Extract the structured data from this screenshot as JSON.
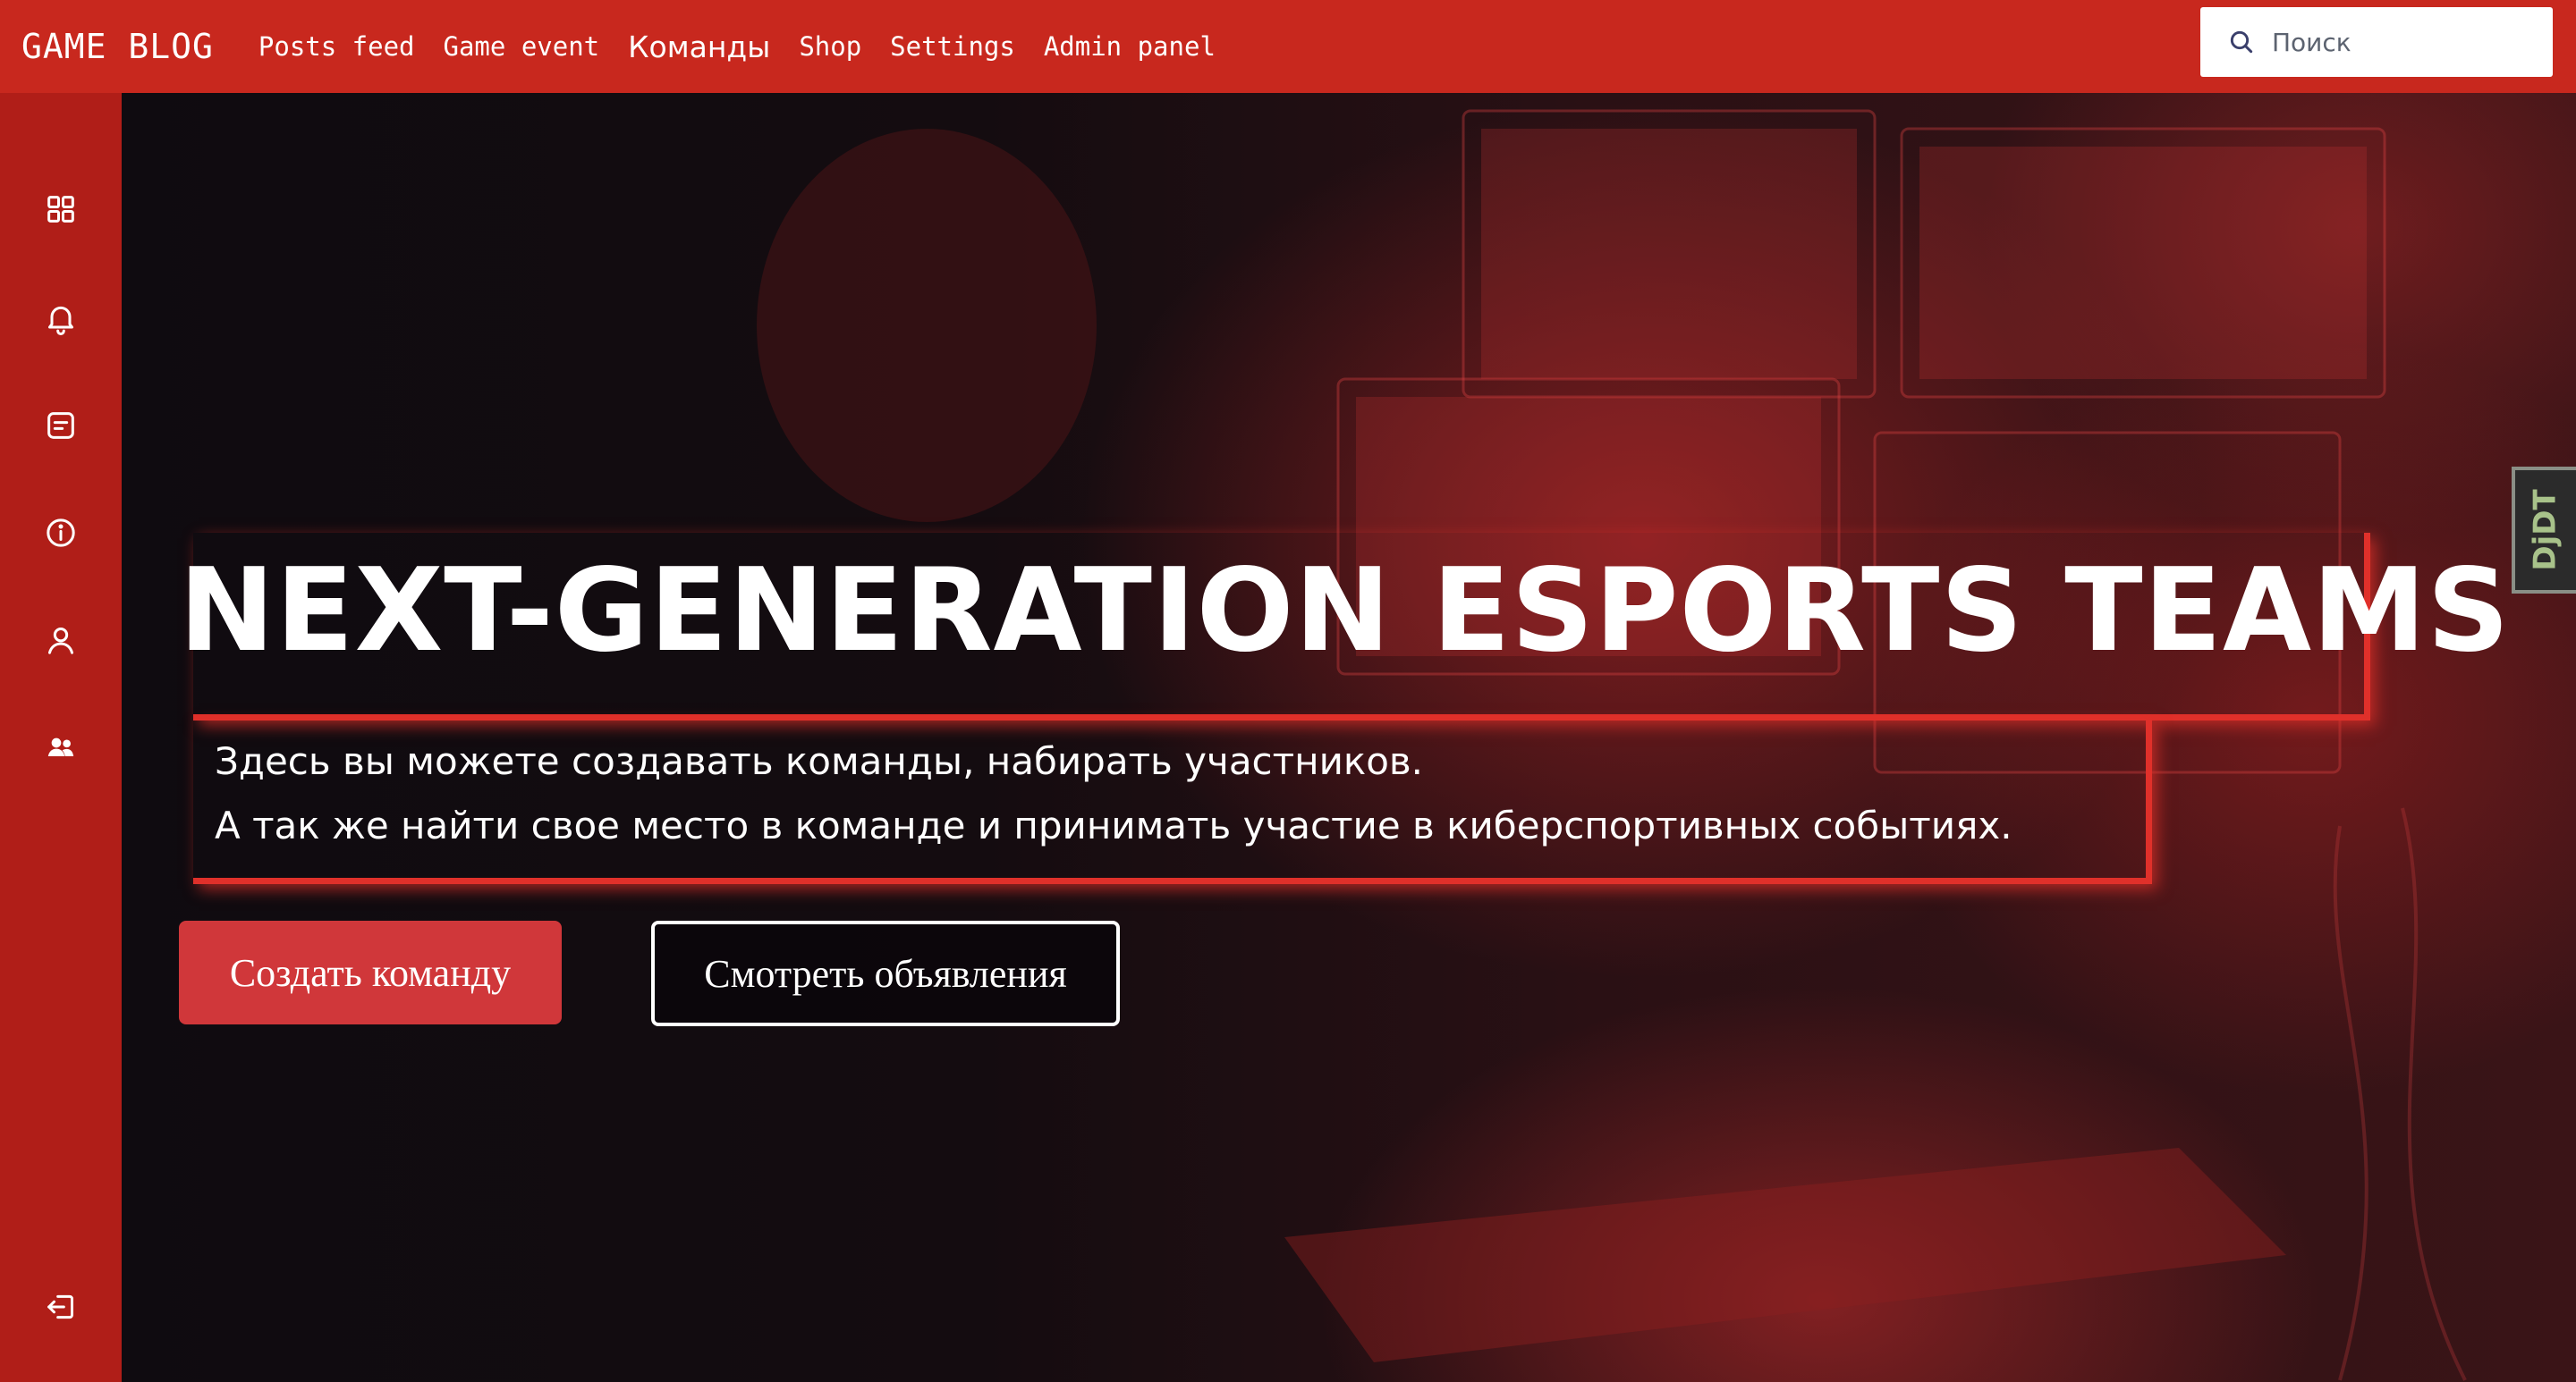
{
  "header": {
    "brand": "GAME BLOG",
    "nav": [
      {
        "label": "Posts feed"
      },
      {
        "label": "Game event"
      },
      {
        "label": "Команды"
      },
      {
        "label": "Shop"
      },
      {
        "label": "Settings"
      },
      {
        "label": "Admin panel"
      }
    ],
    "active_nav": "Команды",
    "search": {
      "placeholder": "Поиск",
      "icon": "search-icon"
    }
  },
  "sidebar": {
    "items": [
      {
        "icon": "dashboard-grid-icon"
      },
      {
        "icon": "bell-icon"
      },
      {
        "icon": "note-icon"
      },
      {
        "icon": "info-icon"
      },
      {
        "icon": "user-icon"
      },
      {
        "icon": "users-group-icon"
      }
    ],
    "bottom": {
      "icon": "logout-icon"
    }
  },
  "hero": {
    "title": "NEXT-GENERATION ESPORTS TEAMS",
    "subtitle_lines": [
      "Здесь вы можете создавать команды, набирать участников.",
      "А так же найти свое место в команде и принимать участие в киберспортивных событиях."
    ],
    "buttons": {
      "create": "Создать команду",
      "view": "Смотреть объявления"
    }
  },
  "debug_toolbar": {
    "label": "DjDT"
  },
  "colors": {
    "brand_red": "#c8281e",
    "sidebar_red": "#b01e18",
    "accent_red": "#e0302a",
    "button_red": "#d0373a"
  }
}
